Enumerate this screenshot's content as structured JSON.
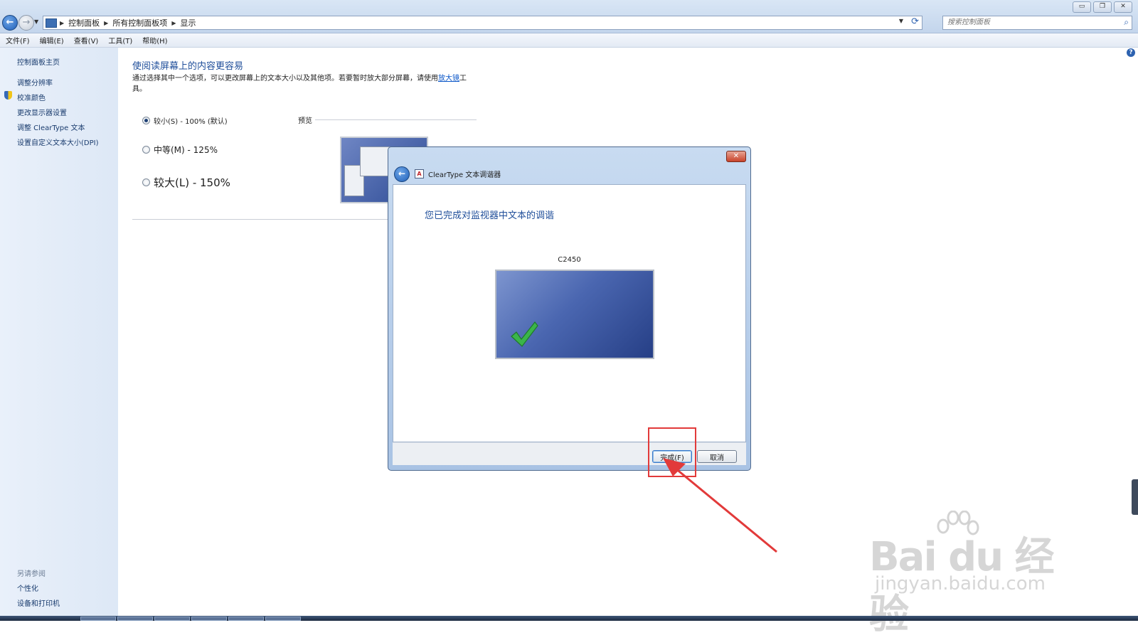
{
  "address": {
    "crumbs": [
      "控制面板",
      "所有控制面板项",
      "显示"
    ],
    "search_placeholder": "搜索控制面板"
  },
  "window_controls": {
    "minimize": "▭",
    "restore": "❐",
    "close": "✕"
  },
  "menu": [
    "文件(F)",
    "编辑(E)",
    "查看(V)",
    "工具(T)",
    "帮助(H)"
  ],
  "sidebar": {
    "home": "控制面板主页",
    "items": [
      "调整分辨率",
      "校准颜色",
      "更改显示器设置",
      "调整 ClearType 文本",
      "设置自定义文本大小(DPI)"
    ],
    "see_also_label": "另请参阅",
    "see_also": [
      "个性化",
      "设备和打印机"
    ]
  },
  "main": {
    "title": "使阅读屏幕上的内容更容易",
    "desc_before": "通过选择其中一个选项，可以更改屏幕上的文本大小以及其他项。若要暂时放大部分屏幕，请使用",
    "desc_link": "放大镜",
    "desc_after": "工具。",
    "options": [
      {
        "label": "较小(S) - 100% (默认)",
        "checked": true
      },
      {
        "label": "中等(M) - 125%",
        "checked": false
      },
      {
        "label": "较大(L) - 150%",
        "checked": false
      }
    ],
    "preview_label": "预览"
  },
  "dialog": {
    "title": "ClearType 文本调谐器",
    "heading": "您已完成对监视器中文本的调谐",
    "monitor_name": "C2450",
    "finish_label": "完成(F)",
    "cancel_label": "取消"
  },
  "watermark": {
    "brand": "Bai du 经验",
    "url": "jingyan.baidu.com"
  },
  "colors": {
    "accent": "#1f4e9a",
    "link": "#0a56c8",
    "annotation": "#e23a3a"
  }
}
